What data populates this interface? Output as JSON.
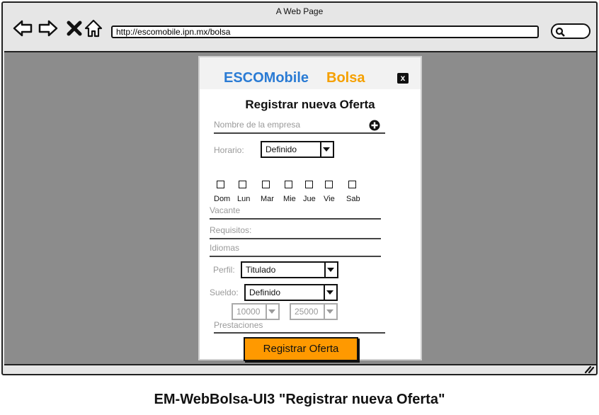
{
  "browser": {
    "title": "A Web Page",
    "url": "http://escomobile.ipn.mx/bolsa",
    "nav_icons": [
      "back-icon",
      "forward-icon",
      "close-icon",
      "home-icon"
    ],
    "search_icon": "search-icon"
  },
  "modal": {
    "brand_primary": "ESCOMobile",
    "brand_secondary": "Bolsa",
    "brand_primary_color": "#2a7bd4",
    "brand_secondary_color": "#f5a000",
    "close_label": "x",
    "title": "Registrar nueva Oferta",
    "company": {
      "placeholder": "Nombre de la empresa"
    },
    "horario": {
      "label": "Horario:",
      "value": "Definido"
    },
    "days": [
      "Dom",
      "Lun",
      "Mar",
      "Mie",
      "Jue",
      "Vie",
      "Sab"
    ],
    "vacante": {
      "placeholder": "Vacante"
    },
    "requisitos": {
      "placeholder": "Requisitos:"
    },
    "idiomas": {
      "placeholder": "Idiomas"
    },
    "perfil": {
      "label": "Perfil:",
      "value": "Titulado"
    },
    "sueldo": {
      "label": "Sueldo:",
      "value": "Definido",
      "min": "10000",
      "max": "25000"
    },
    "prestaciones": {
      "placeholder": "Prestaciones"
    },
    "submit_label": "Registrar Oferta",
    "submit_color": "#ff9900"
  },
  "caption": "EM-WebBolsa-UI3 \"Registrar nueva Oferta\""
}
